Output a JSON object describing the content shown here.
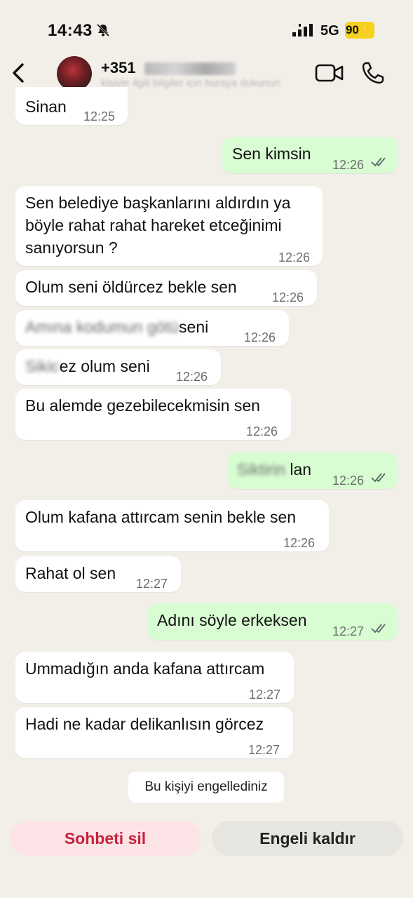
{
  "status_bar": {
    "time": "14:43",
    "network": "5G",
    "battery": "90"
  },
  "header": {
    "contact_prefix": "+351",
    "contact_subtitle": "kişiyle ilgili bilgiler için buraya dokunun"
  },
  "messages": [
    {
      "dir": "in",
      "text": "Sinan",
      "time": "12:25"
    },
    {
      "dir": "out",
      "text": "Sen kimsin",
      "time": "12:26"
    },
    {
      "dir": "in",
      "text_lines": [
        "Sen belediye başkanlarını aldırdın ya",
        "böyle rahat rahat hareket etceğinimi",
        "sanıyorsun ?"
      ],
      "time": "12:26"
    },
    {
      "dir": "in",
      "text": "Olum seni öldürcez bekle sen",
      "time": "12:26"
    },
    {
      "dir": "in",
      "text_blurred": "Amına kodumun götü",
      "text": "seni",
      "time": "12:26"
    },
    {
      "dir": "in",
      "text_blurred": "Sikic",
      "text": "ez olum seni",
      "time": "12:26"
    },
    {
      "dir": "in",
      "text": "Bu alemde gezebilecekmisin sen",
      "time": "12:26"
    },
    {
      "dir": "out",
      "text_blurred": "Siktirin",
      "text": "lan",
      "time": "12:26"
    },
    {
      "dir": "in",
      "text": "Olum kafana attırcam senin bekle sen",
      "time": "12:26"
    },
    {
      "dir": "in",
      "text": "Rahat ol sen",
      "time": "12:27"
    },
    {
      "dir": "out",
      "text": "Adını söyle erkeksen",
      "time": "12:27"
    },
    {
      "dir": "in",
      "text": "Ummadığın anda kafana attırcam",
      "time": "12:27"
    },
    {
      "dir": "in",
      "text": "Hadi ne kadar delikanlısın görcez",
      "time": "12:27"
    }
  ],
  "notice": "Bu kişiyi engellediniz",
  "actions": {
    "delete_chat": "Sohbeti sil",
    "unblock": "Engeli kaldır"
  },
  "colors": {
    "background": "#f2efe9",
    "incoming_bubble": "#ffffff",
    "outgoing_bubble": "#d9fdd3",
    "delete_text": "#c8223c",
    "battery": "#f5d21f"
  },
  "icons": [
    "bell-muted-icon",
    "signal-icon",
    "back-icon",
    "video-call-icon",
    "phone-icon",
    "double-check-icon"
  ]
}
